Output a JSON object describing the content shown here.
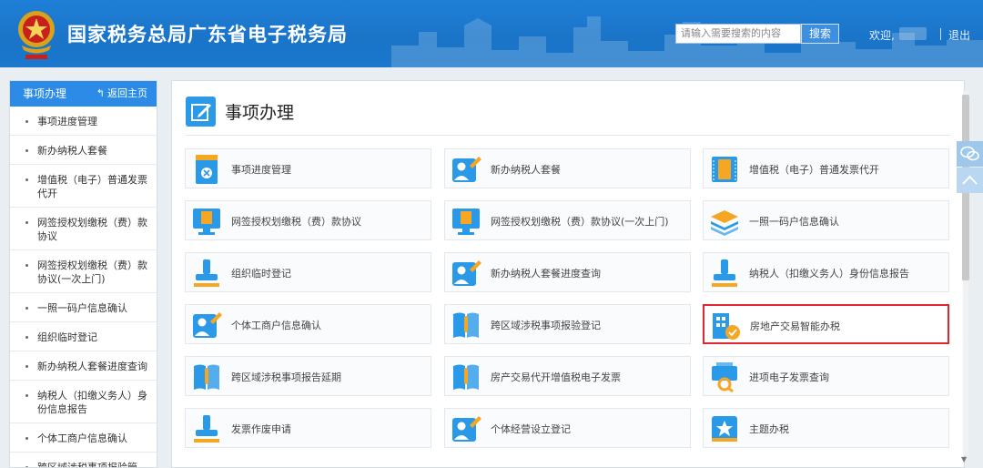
{
  "header": {
    "title": "国家税务总局广东省电子税务局",
    "search_placeholder": "请输入需要搜索的内容",
    "search_button": "搜索",
    "welcome": "欢迎,",
    "logout": "退出",
    "brand_color": "#1f7fd6"
  },
  "sidebar": {
    "title": "事项办理",
    "back_home": "返回主页",
    "items": [
      {
        "label": "事项进度管理"
      },
      {
        "label": "新办纳税人套餐"
      },
      {
        "label": "增值税（电子）普通发票代开"
      },
      {
        "label": "网签授权划缴税（费）款协议"
      },
      {
        "label": "网签授权划缴税（费）款协议(一次上门)"
      },
      {
        "label": "一照一码户信息确认"
      },
      {
        "label": "组织临时登记"
      },
      {
        "label": "新办纳税人套餐进度查询"
      },
      {
        "label": "纳税人（扣缴义务人）身份信息报告"
      },
      {
        "label": "个体工商户信息确认"
      },
      {
        "label": "跨区域涉税事项报验管"
      }
    ]
  },
  "main": {
    "title": "事项办理",
    "tiles": [
      {
        "label": "事项进度管理",
        "icon": "progress-doc-icon"
      },
      {
        "label": "新办纳税人套餐",
        "icon": "user-edit-icon"
      },
      {
        "label": "增值税（电子）普通发票代开",
        "icon": "invoice-icon"
      },
      {
        "label": "网签授权划缴税（费）款协议",
        "icon": "monitor-tax-icon"
      },
      {
        "label": "网签授权划缴税（费）款协议(一次上门)",
        "icon": "monitor-tax-icon"
      },
      {
        "label": "一照一码户信息确认",
        "icon": "layers-icon"
      },
      {
        "label": "组织临时登记",
        "icon": "stamp-icon"
      },
      {
        "label": "新办纳税人套餐进度查询",
        "icon": "user-edit-icon"
      },
      {
        "label": "纳税人（扣缴义务人）身份信息报告",
        "icon": "stamp-icon"
      },
      {
        "label": "个体工商户信息确认",
        "icon": "user-edit-icon"
      },
      {
        "label": "跨区域涉税事项报验登记",
        "icon": "book-icon"
      },
      {
        "label": "房地产交易智能办税",
        "icon": "building-check-icon",
        "active": true
      },
      {
        "label": "跨区域涉税事项报告延期",
        "icon": "book-icon"
      },
      {
        "label": "房产交易代开增值税电子发票",
        "icon": "book-icon"
      },
      {
        "label": "进项电子发票查询",
        "icon": "invoice-search-icon"
      },
      {
        "label": "发票作废申请",
        "icon": "stamp-icon"
      },
      {
        "label": "个体经营设立登记",
        "icon": "user-edit-icon"
      },
      {
        "label": "主题办税",
        "icon": "star-book-icon"
      }
    ]
  },
  "colors": {
    "accent": "#2b8be6",
    "active_border": "#e0272f",
    "icon_blue": "#2a9ae8",
    "icon_orange": "#f5a623"
  }
}
